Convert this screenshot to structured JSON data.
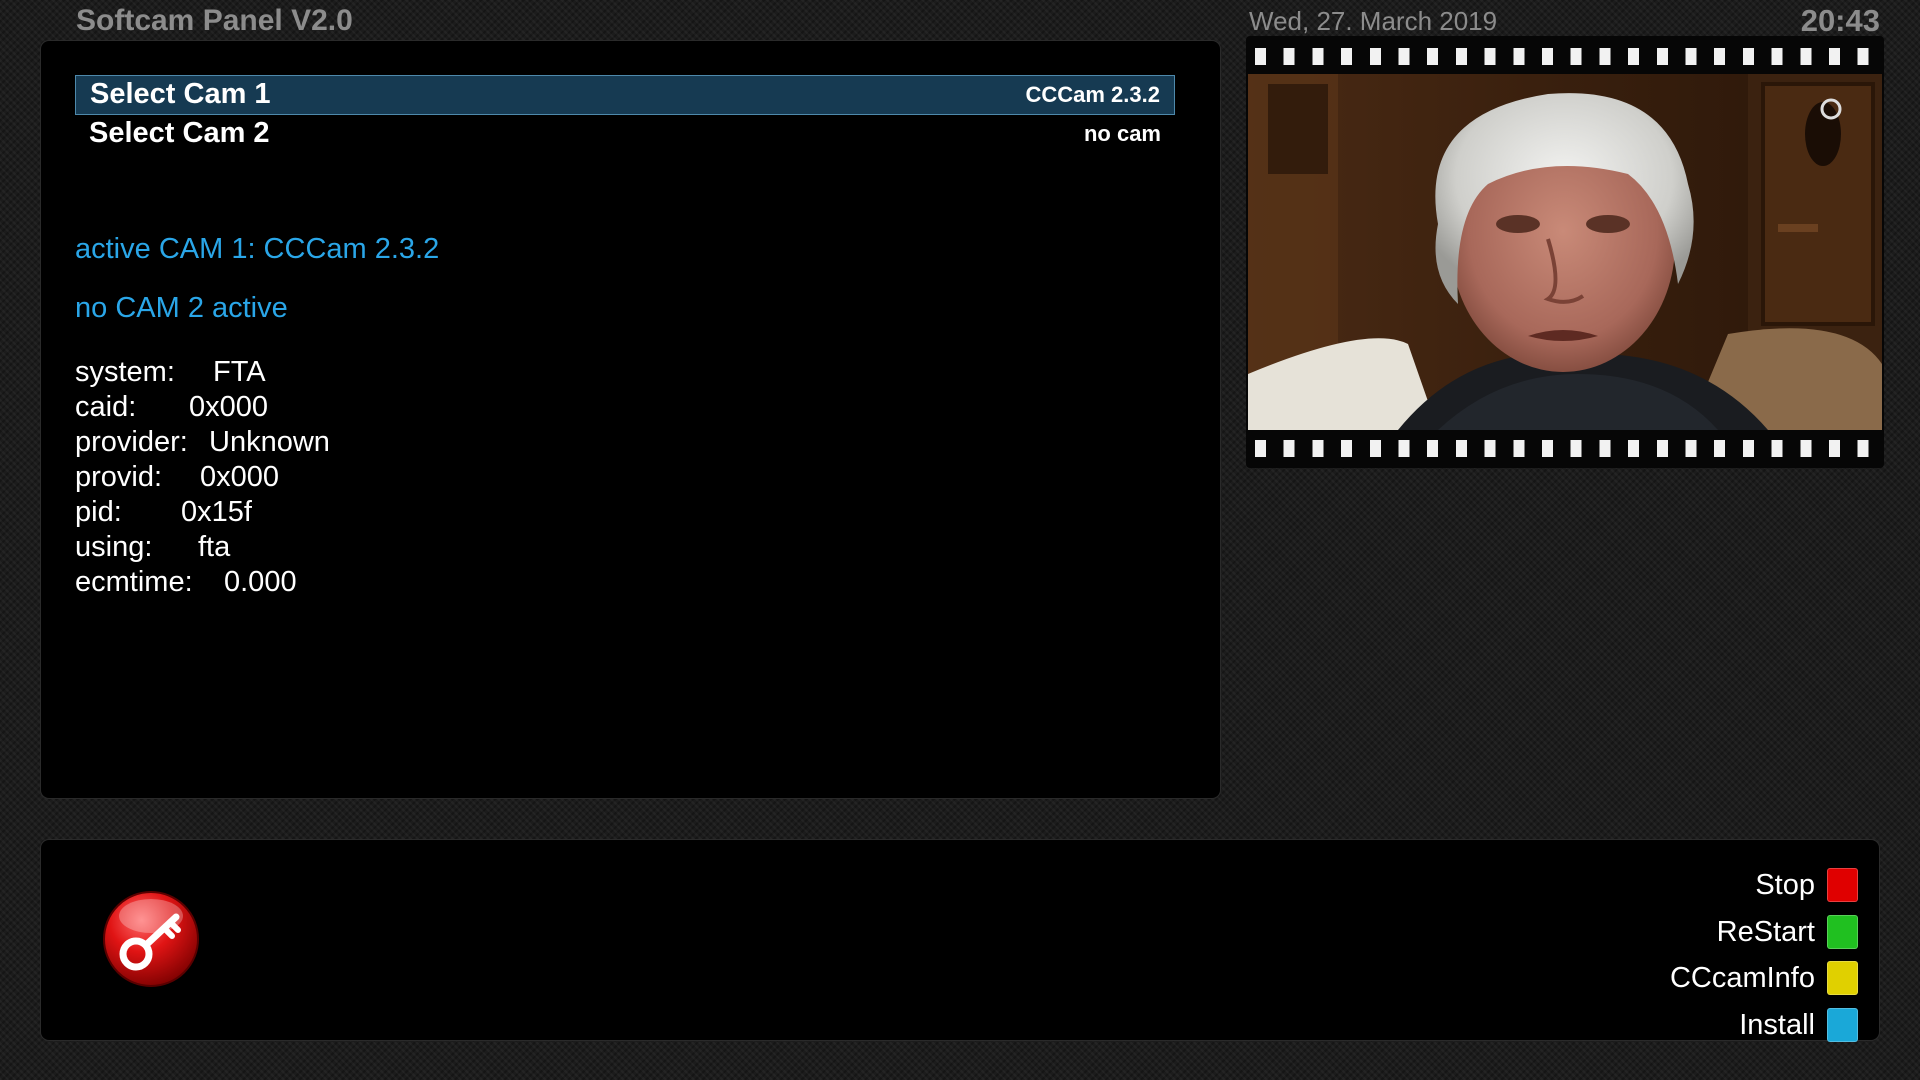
{
  "header": {
    "title": "Softcam Panel V2.0",
    "date": "Wed, 27. March 2019",
    "time": "20:43"
  },
  "menu": {
    "items": [
      {
        "label": "Select Cam 1",
        "value": "CCCam 2.3.2",
        "selected": true
      },
      {
        "label": "Select Cam 2",
        "value": "no cam",
        "selected": false
      }
    ]
  },
  "status": {
    "cam1": "active CAM 1: CCCam 2.3.2",
    "cam2": "no CAM 2 active"
  },
  "info": [
    {
      "key": "system:",
      "value": "FTA"
    },
    {
      "key": "caid:",
      "value": "0x000"
    },
    {
      "key": "provider:",
      "value": "Unknown"
    },
    {
      "key": "provid:",
      "value": "0x000"
    },
    {
      "key": "pid:",
      "value": "0x15f"
    },
    {
      "key": "using:",
      "value": "fta"
    },
    {
      "key": "ecmtime:",
      "value": "0.000"
    }
  ],
  "preview": {
    "icon": "film-strip-tv-preview"
  },
  "footer": {
    "logo_icon": "key-icon",
    "buttons": [
      {
        "label": "Stop",
        "color": "#e00000"
      },
      {
        "label": "ReStart",
        "color": "#20c020"
      },
      {
        "label": "CCcamInfo",
        "color": "#e0d000"
      },
      {
        "label": "Install",
        "color": "#1aa8d8"
      }
    ]
  }
}
